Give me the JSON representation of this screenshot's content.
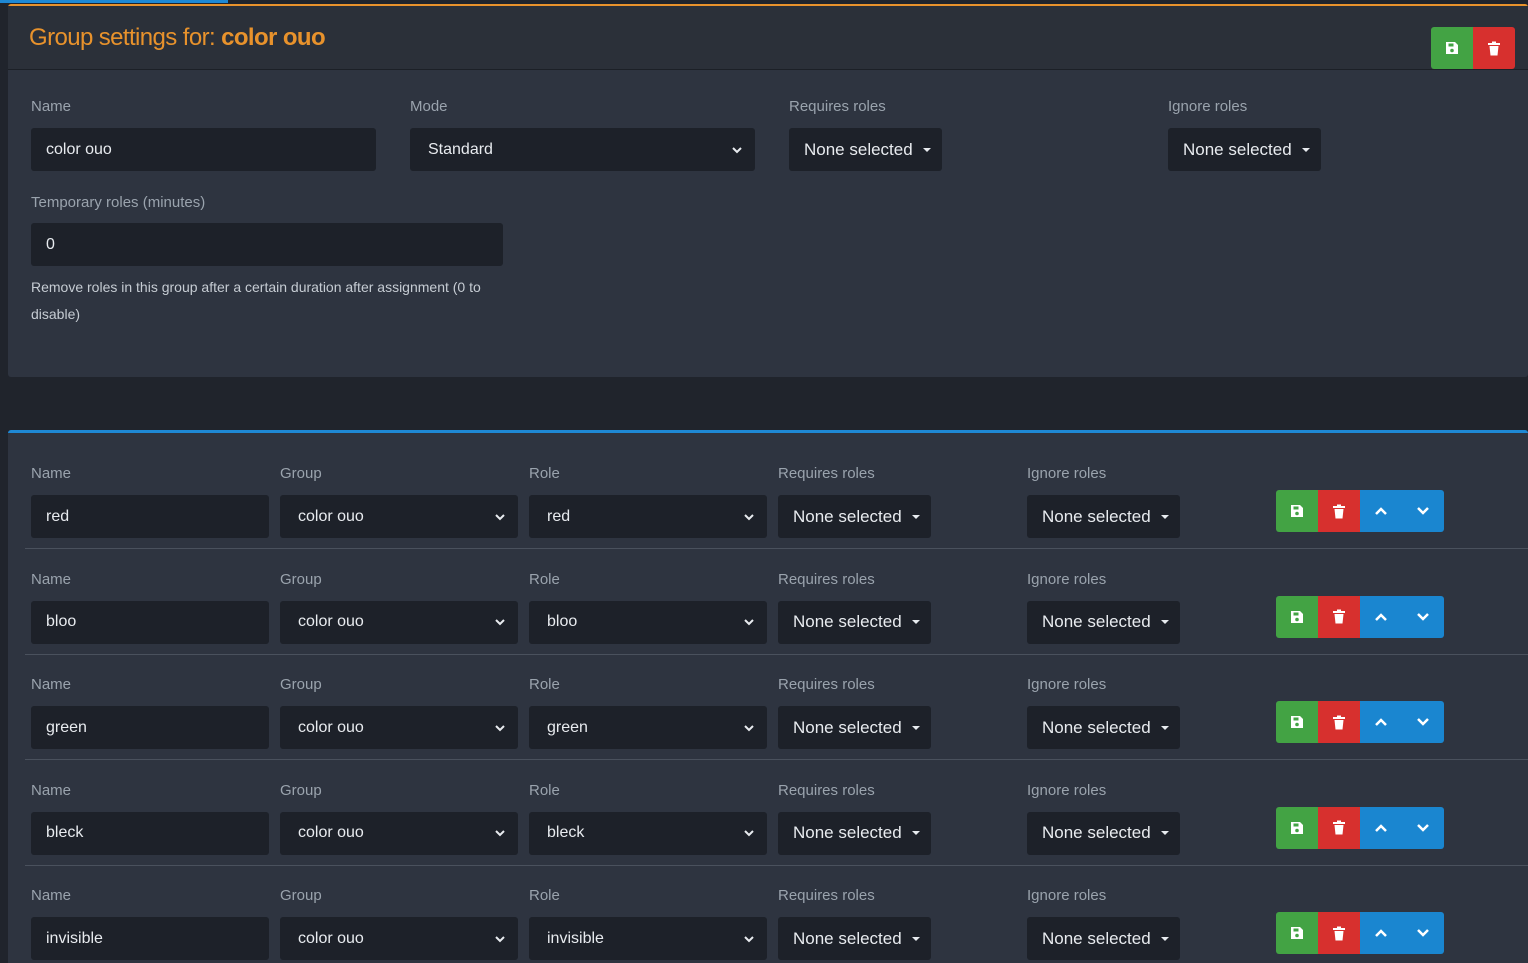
{
  "group": {
    "title_prefix": "Group settings for:",
    "title_name": "color ouo",
    "fields": {
      "name_label": "Name",
      "name_value": "color ouo",
      "mode_label": "Mode",
      "mode_value": "Standard",
      "requires_label": "Requires roles",
      "requires_value": "None selected",
      "ignore_label": "Ignore roles",
      "ignore_value": "None selected",
      "temp_label": "Temporary roles (minutes)",
      "temp_value": "0",
      "temp_help": "Remove roles in this group after a certain duration after assignment (0 to disable)"
    },
    "colors": {
      "accent": "#e8922c",
      "save": "#43a344",
      "delete": "#d7302e"
    }
  },
  "roles_panel": {
    "labels": {
      "name": "Name",
      "group": "Group",
      "role": "Role",
      "requires": "Requires roles",
      "ignore": "Ignore roles"
    },
    "rows": [
      {
        "name": "red",
        "group": "color ouo",
        "role": "red",
        "requires": "None selected",
        "ignore": "None selected"
      },
      {
        "name": "bloo",
        "group": "color ouo",
        "role": "bloo",
        "requires": "None selected",
        "ignore": "None selected"
      },
      {
        "name": "green",
        "group": "color ouo",
        "role": "green",
        "requires": "None selected",
        "ignore": "None selected"
      },
      {
        "name": "bleck",
        "group": "color ouo",
        "role": "bleck",
        "requires": "None selected",
        "ignore": "None selected"
      },
      {
        "name": "invisible",
        "group": "color ouo",
        "role": "invisible",
        "requires": "None selected",
        "ignore": "None selected"
      }
    ],
    "icons": [
      "save-icon",
      "trash-icon",
      "chevron-up-icon",
      "chevron-down-icon"
    ],
    "colors": {
      "accent": "#1e88d4",
      "move": "#1a86d0"
    }
  }
}
